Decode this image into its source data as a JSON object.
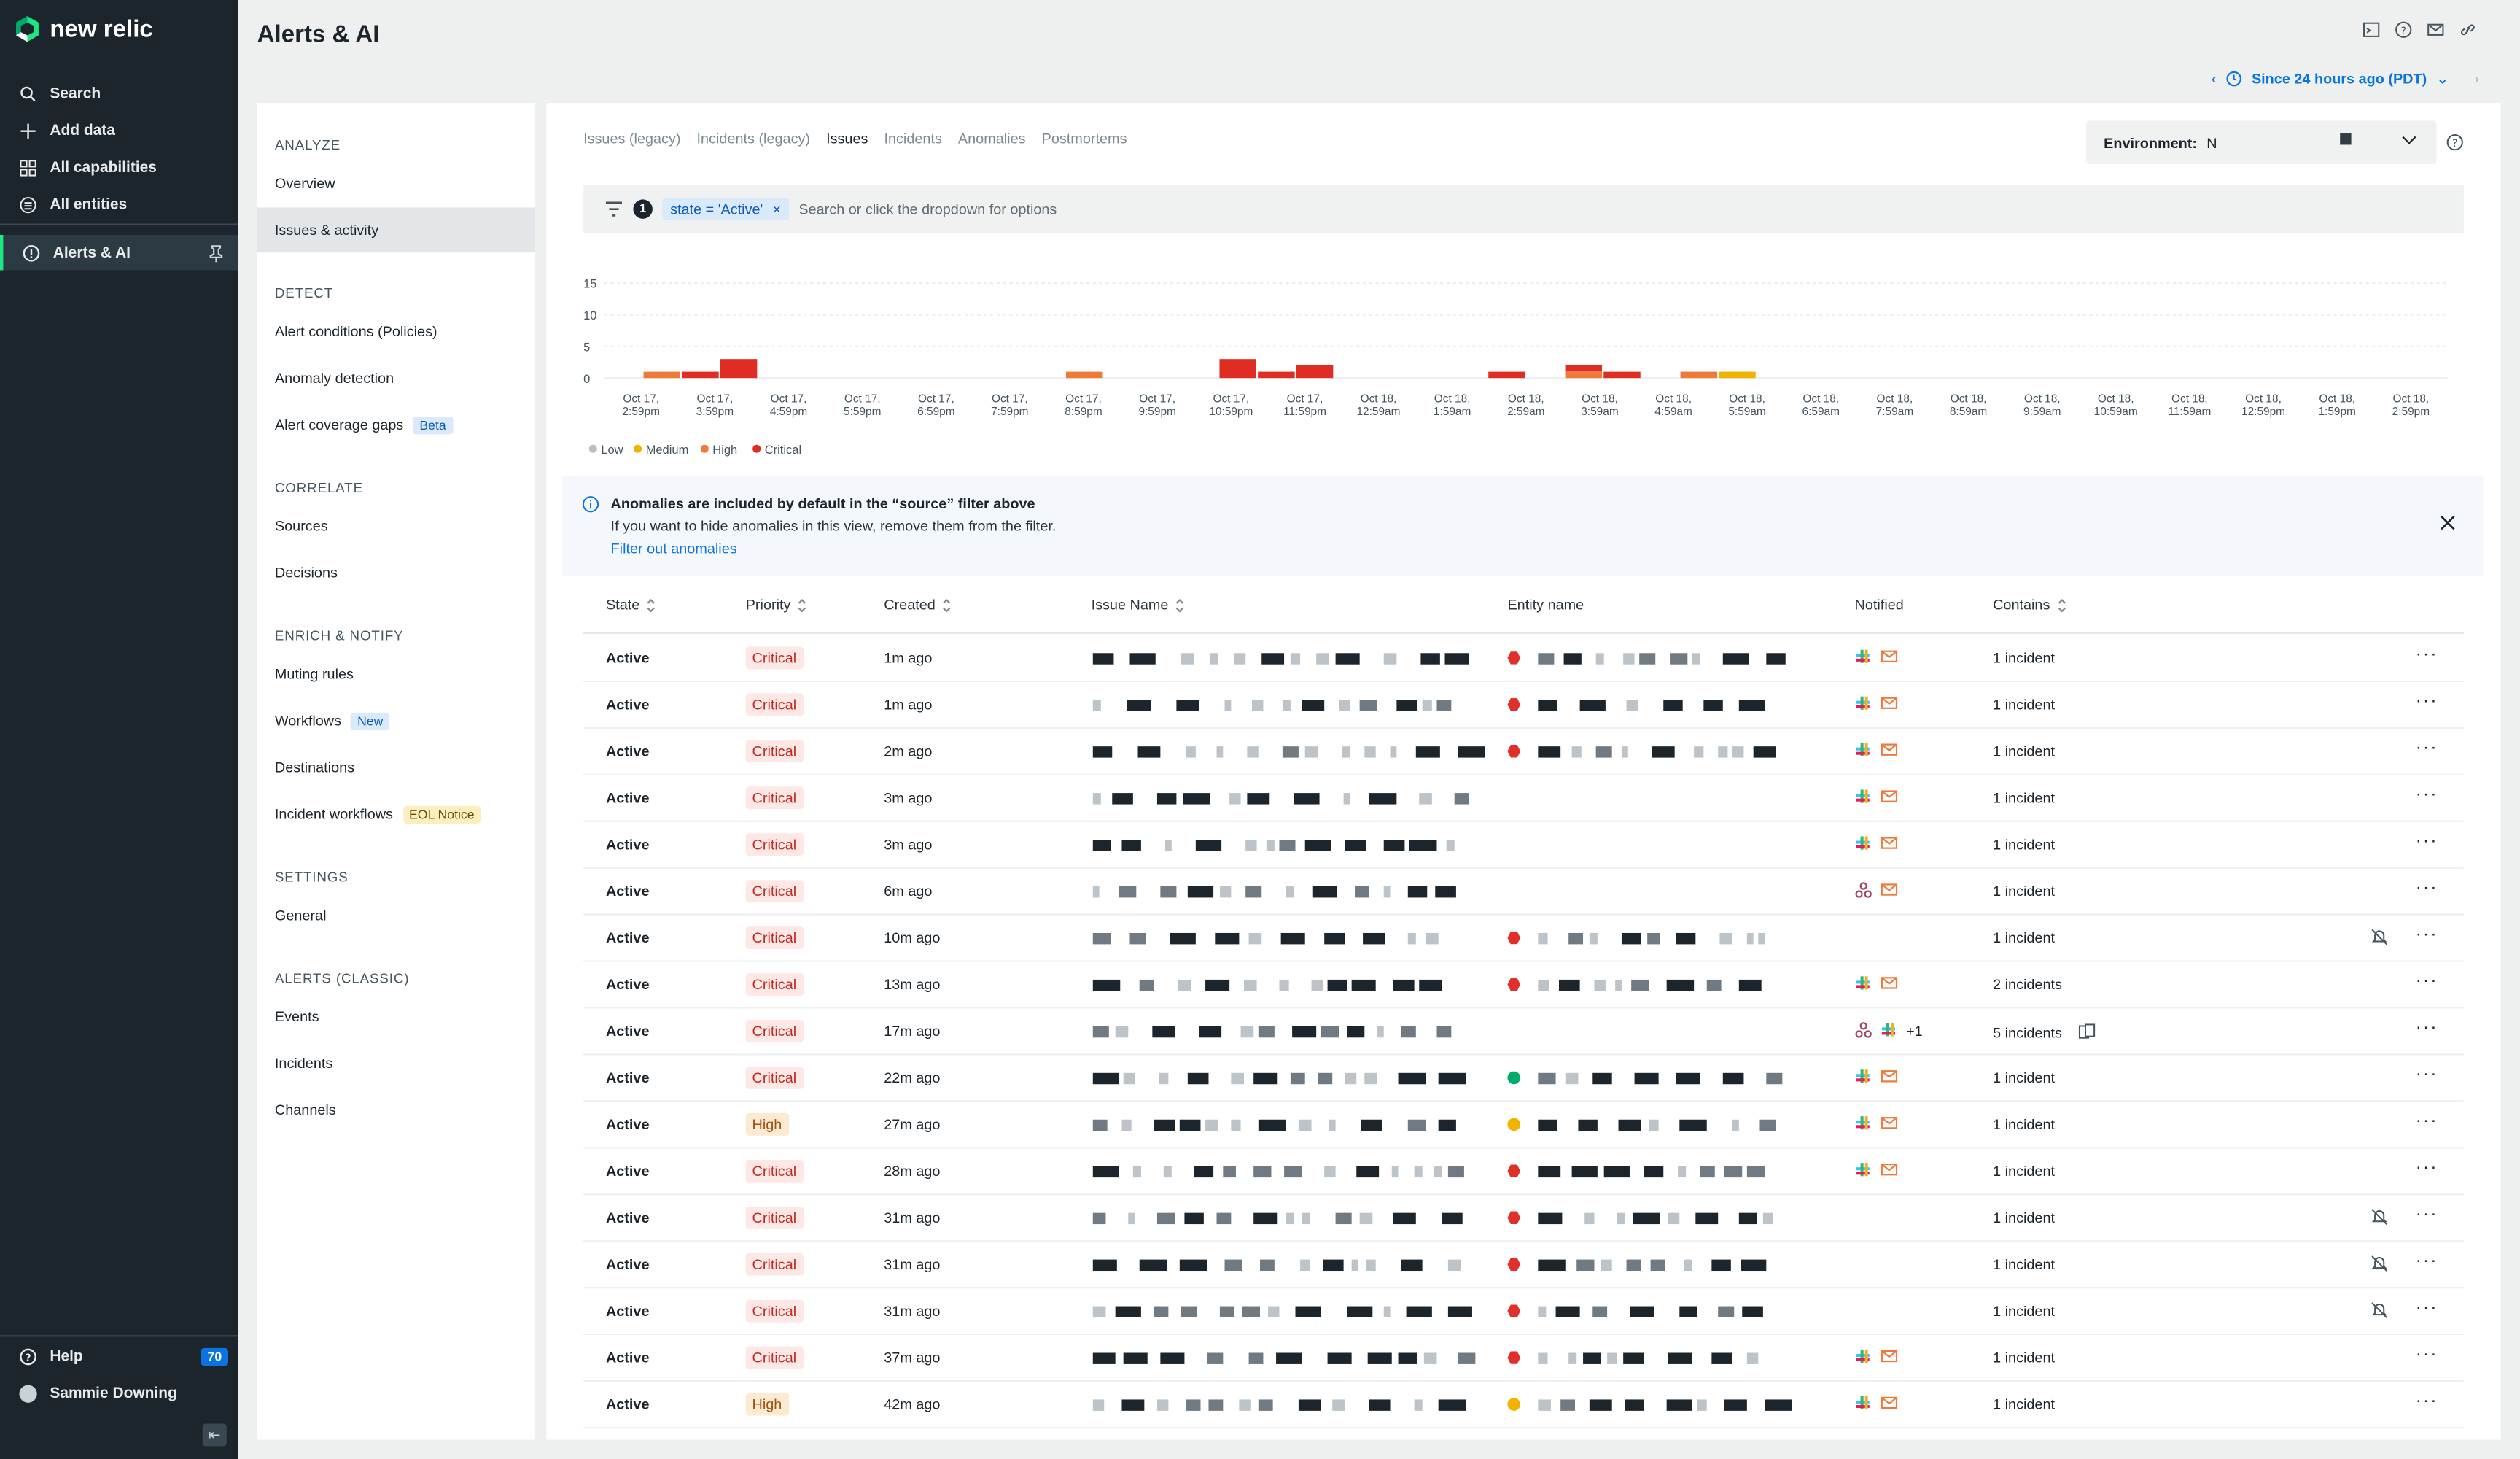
{
  "brand": {
    "name": "new relic"
  },
  "nav": {
    "items": [
      {
        "label": "Search",
        "icon": "search-icon"
      },
      {
        "label": "Add data",
        "icon": "plus-icon"
      },
      {
        "label": "All capabilities",
        "icon": "grid-icon"
      },
      {
        "label": "All entities",
        "icon": "entities-icon"
      }
    ],
    "active": {
      "label": "Alerts & AI",
      "icon": "alert-icon",
      "pin_icon": "pin-icon"
    },
    "help": {
      "label": "Help",
      "count": "70"
    },
    "user": {
      "name": "Sammie Downing"
    }
  },
  "page": {
    "title": "Alerts & AI"
  },
  "time_picker": {
    "label": "Since 24 hours ago (PDT)"
  },
  "sidebar": {
    "sections": [
      {
        "title": "ANALYZE",
        "items": [
          {
            "label": "Overview"
          },
          {
            "label": "Issues & activity",
            "active": true
          }
        ]
      },
      {
        "title": "DETECT",
        "items": [
          {
            "label": "Alert conditions (Policies)"
          },
          {
            "label": "Anomaly detection"
          },
          {
            "label": "Alert coverage gaps",
            "tag": "Beta"
          }
        ]
      },
      {
        "title": "CORRELATE",
        "items": [
          {
            "label": "Sources"
          },
          {
            "label": "Decisions"
          }
        ]
      },
      {
        "title": "ENRICH & NOTIFY",
        "items": [
          {
            "label": "Muting rules"
          },
          {
            "label": "Workflows",
            "tag": "New"
          },
          {
            "label": "Destinations"
          },
          {
            "label": "Incident workflows",
            "tag": "EOL Notice"
          }
        ]
      },
      {
        "title": "SETTINGS",
        "items": [
          {
            "label": "General"
          }
        ]
      },
      {
        "title": "ALERTS (CLASSIC)",
        "items": [
          {
            "label": "Events"
          },
          {
            "label": "Incidents"
          },
          {
            "label": "Channels"
          }
        ]
      }
    ]
  },
  "tabs": [
    {
      "label": "Issues (legacy)"
    },
    {
      "label": "Incidents (legacy)"
    },
    {
      "label": "Issues",
      "active": true
    },
    {
      "label": "Incidents"
    },
    {
      "label": "Anomalies"
    },
    {
      "label": "Postmortems"
    }
  ],
  "environment": {
    "label": "Environment:",
    "value": "N"
  },
  "filter": {
    "count": "1",
    "pill": "state = 'Active'",
    "pill_close": "×",
    "placeholder": "Search or click the dropdown for options"
  },
  "chart_data": {
    "type": "bar",
    "stacked": true,
    "title": "",
    "ylim": [
      0,
      15
    ],
    "yticks": [
      "15",
      "10",
      "5",
      "0"
    ],
    "ytick_values": [
      15,
      10,
      5,
      0
    ],
    "xtick_labels": [
      "Oct 17, 2:59pm",
      "Oct 17, 3:59pm",
      "Oct 17, 4:59pm",
      "Oct 17, 5:59pm",
      "Oct 17, 6:59pm",
      "Oct 17, 7:59pm",
      "Oct 17, 8:59pm",
      "Oct 17, 9:59pm",
      "Oct 17, 10:59pm",
      "Oct 17, 11:59pm",
      "Oct 18, 12:59am",
      "Oct 18, 1:59am",
      "Oct 18, 2:59am",
      "Oct 18, 3:59am",
      "Oct 18, 4:59am",
      "Oct 18, 5:59am",
      "Oct 18, 6:59am",
      "Oct 18, 7:59am",
      "Oct 18, 8:59am",
      "Oct 18, 9:59am",
      "Oct 18, 10:59am",
      "Oct 18, 11:59am",
      "Oct 18, 12:59pm",
      "Oct 18, 1:59pm",
      "Oct 18, 2:59pm"
    ],
    "bin_count": 48,
    "series": [
      {
        "name": "Low",
        "color": "#b9bfc3",
        "values": [
          0,
          0,
          0,
          0,
          0,
          0,
          0,
          0,
          0,
          0,
          0,
          0,
          0,
          0,
          0,
          0,
          0,
          0,
          0,
          0,
          0,
          0,
          0,
          0,
          0,
          0,
          0,
          0,
          0,
          0,
          0,
          0,
          0,
          0,
          0,
          0,
          0,
          0,
          0,
          0,
          0,
          0,
          0,
          0,
          0,
          0,
          0,
          0
        ]
      },
      {
        "name": "Medium",
        "color": "#f0b400",
        "values": [
          0,
          0,
          0,
          0,
          0,
          0,
          0,
          0,
          0,
          0,
          0,
          0,
          0,
          0,
          0,
          0,
          0,
          0,
          0,
          0,
          0,
          0,
          0,
          0,
          0,
          0,
          0,
          0,
          0,
          1,
          0,
          0,
          0,
          0,
          0,
          0,
          0,
          0,
          0,
          0,
          0,
          0,
          0,
          0,
          0,
          0,
          0,
          0
        ]
      },
      {
        "name": "High",
        "color": "#ee7a3a",
        "values": [
          0,
          1,
          0,
          0,
          0,
          0,
          0,
          0,
          0,
          0,
          0,
          0,
          1,
          0,
          0,
          0,
          0,
          0,
          0,
          0,
          0,
          0,
          0,
          0,
          0,
          1,
          0,
          0,
          1,
          0,
          0,
          0,
          0,
          0,
          0,
          0,
          0,
          0,
          0,
          0,
          0,
          0,
          0,
          0,
          0,
          0,
          0,
          0
        ]
      },
      {
        "name": "Critical",
        "color": "#df2d24",
        "values": [
          0,
          0,
          1,
          3,
          0,
          0,
          0,
          0,
          0,
          0,
          0,
          0,
          0,
          0,
          0,
          0,
          3,
          1,
          2,
          0,
          0,
          0,
          0,
          1,
          0,
          1,
          1,
          0,
          0,
          0,
          0,
          0,
          0,
          0,
          0,
          0,
          0,
          0,
          0,
          0,
          0,
          0,
          0,
          0,
          0,
          0,
          0,
          0
        ]
      }
    ],
    "legend": [
      "Low",
      "Medium",
      "High",
      "Critical"
    ],
    "legend_position": "bottom-left"
  },
  "banner": {
    "title": "Anomalies are included by default in the “source” filter above",
    "text": "If you want to hide anomalies in this view, remove them from the filter.",
    "link": "Filter out anomalies"
  },
  "table": {
    "columns": [
      "State",
      "Priority",
      "Created",
      "Issue Name",
      "Entity name",
      "Notified",
      "Contains"
    ],
    "rows": [
      {
        "state": "Active",
        "priority": "Critical",
        "created": "1m ago",
        "entity_status": "critical",
        "notified": [
          "slack-icon",
          "email-icon"
        ],
        "extra": "",
        "contains": "1 incident",
        "muted": false
      },
      {
        "state": "Active",
        "priority": "Critical",
        "created": "1m ago",
        "entity_status": "critical",
        "notified": [
          "slack-icon",
          "email-icon"
        ],
        "extra": "",
        "contains": "1 incident",
        "muted": false
      },
      {
        "state": "Active",
        "priority": "Critical",
        "created": "2m ago",
        "entity_status": "critical",
        "notified": [
          "slack-icon",
          "email-icon"
        ],
        "extra": "",
        "contains": "1 incident",
        "muted": false
      },
      {
        "state": "Active",
        "priority": "Critical",
        "created": "3m ago",
        "entity_status": "none",
        "notified": [
          "slack-icon",
          "email-icon"
        ],
        "extra": "",
        "contains": "1 incident",
        "muted": false
      },
      {
        "state": "Active",
        "priority": "Critical",
        "created": "3m ago",
        "entity_status": "none",
        "notified": [
          "slack-icon",
          "email-icon"
        ],
        "extra": "",
        "contains": "1 incident",
        "muted": false
      },
      {
        "state": "Active",
        "priority": "Critical",
        "created": "6m ago",
        "entity_status": "none",
        "notified": [
          "webhook-icon",
          "email-icon"
        ],
        "extra": "",
        "contains": "1 incident",
        "muted": false
      },
      {
        "state": "Active",
        "priority": "Critical",
        "created": "10m ago",
        "entity_status": "critical",
        "notified": [],
        "extra": "",
        "contains": "1 incident",
        "muted": true
      },
      {
        "state": "Active",
        "priority": "Critical",
        "created": "13m ago",
        "entity_status": "critical",
        "notified": [
          "slack-icon",
          "email-icon"
        ],
        "extra": "",
        "contains": "2 incidents",
        "muted": false
      },
      {
        "state": "Active",
        "priority": "Critical",
        "created": "17m ago",
        "entity_status": "none",
        "notified": [
          "webhook-icon",
          "slack-icon"
        ],
        "extra": "+1",
        "contains": "5 incidents",
        "muted": false
      },
      {
        "state": "Active",
        "priority": "Critical",
        "created": "22m ago",
        "entity_status": "healthy",
        "notified": [
          "slack-icon",
          "email-icon"
        ],
        "extra": "",
        "contains": "1 incident",
        "muted": false
      },
      {
        "state": "Active",
        "priority": "High",
        "created": "27m ago",
        "entity_status": "warning",
        "notified": [
          "slack-icon",
          "email-icon"
        ],
        "extra": "",
        "contains": "1 incident",
        "muted": false
      },
      {
        "state": "Active",
        "priority": "Critical",
        "created": "28m ago",
        "entity_status": "critical",
        "notified": [
          "slack-icon",
          "email-icon"
        ],
        "extra": "",
        "contains": "1 incident",
        "muted": false
      },
      {
        "state": "Active",
        "priority": "Critical",
        "created": "31m ago",
        "entity_status": "critical",
        "notified": [],
        "extra": "",
        "contains": "1 incident",
        "muted": true
      },
      {
        "state": "Active",
        "priority": "Critical",
        "created": "31m ago",
        "entity_status": "critical",
        "notified": [],
        "extra": "",
        "contains": "1 incident",
        "muted": true
      },
      {
        "state": "Active",
        "priority": "Critical",
        "created": "31m ago",
        "entity_status": "critical",
        "notified": [],
        "extra": "",
        "contains": "1 incident",
        "muted": true
      },
      {
        "state": "Active",
        "priority": "Critical",
        "created": "37m ago",
        "entity_status": "critical",
        "notified": [
          "slack-icon",
          "email-icon"
        ],
        "extra": "",
        "contains": "1 incident",
        "muted": false
      },
      {
        "state": "Active",
        "priority": "High",
        "created": "42m ago",
        "entity_status": "warning",
        "notified": [
          "slack-icon",
          "email-icon"
        ],
        "extra": "",
        "contains": "1 incident",
        "muted": false
      }
    ]
  }
}
